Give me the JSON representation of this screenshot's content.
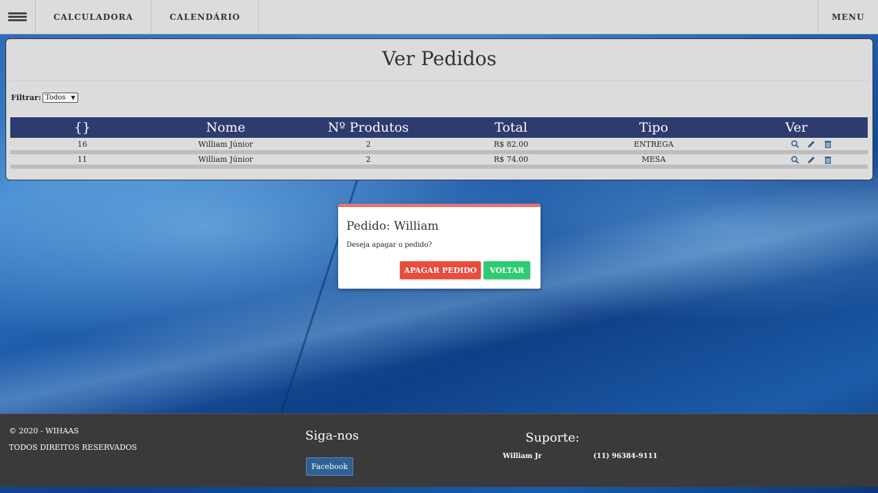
{
  "topbar": {
    "nav": [
      "CALCULADORA",
      "CALENDÁRIO"
    ],
    "menu_label": "MENU"
  },
  "panel": {
    "title": "Ver Pedidos",
    "filter_label": "Filtrar:",
    "filter_value": "Todos"
  },
  "table": {
    "headers": [
      "{}",
      "Nome",
      "Nº Produtos",
      "Total",
      "Tipo",
      "Ver"
    ],
    "rows": [
      {
        "id": "16",
        "name": "William Júnior",
        "products": "2",
        "total": "R$ 82.00",
        "type": "ENTREGA"
      },
      {
        "id": "11",
        "name": "William Júnior",
        "products": "2",
        "total": "R$ 74.00",
        "type": "MESA"
      }
    ]
  },
  "modal": {
    "title": "Pedido: William",
    "message": "Deseja apagar o pedido?",
    "delete_label": "APAGAR PEDIDO",
    "back_label": "VOLTAR"
  },
  "footer": {
    "copyright": "© 2020 - WIHAAS",
    "rights": "TODOS DIREITOS RESERVADOS",
    "follow_title": "Siga-nos",
    "facebook_label": "Facebook",
    "support_title": "Suporte:",
    "support_name": "William Jr",
    "support_phone": "(11) 96384-9111"
  },
  "colors": {
    "table_header": "#2d3b6f",
    "danger": "#e74c3c",
    "success": "#2ecc71",
    "modal_top": "#e57373",
    "footer": "#3a3a3a",
    "icon": "#2d5a8c"
  }
}
